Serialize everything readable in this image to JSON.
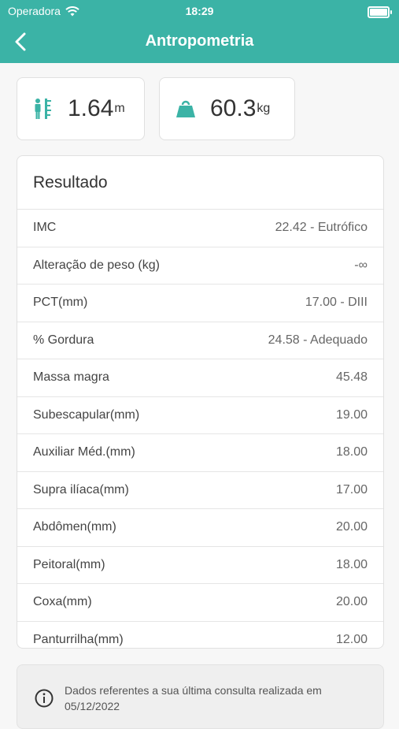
{
  "status_bar": {
    "carrier": "Operadora",
    "time": "18:29",
    "wifi_icon": "wifi-icon",
    "battery_icon": "battery-icon"
  },
  "nav": {
    "title": "Antropometria",
    "back_icon": "chevron-left-icon"
  },
  "metrics": {
    "height": {
      "value": "1.64",
      "unit": "m",
      "icon": "height-ruler-icon"
    },
    "weight": {
      "value": "60.3",
      "unit": "kg",
      "icon": "weight-icon"
    }
  },
  "results": {
    "title": "Resultado",
    "rows": [
      {
        "label": "IMC",
        "value": "22.42 - Eutrófico"
      },
      {
        "label": "Alteração de peso (kg)",
        "value": "-∞"
      },
      {
        "label": "PCT(mm)",
        "value": "17.00 - DIII"
      },
      {
        "label": "% Gordura",
        "value": "24.58 - Adequado"
      },
      {
        "label": "Massa magra",
        "value": "45.48"
      },
      {
        "label": "Subescapular(mm)",
        "value": "19.00"
      },
      {
        "label": "Auxiliar Méd.(mm)",
        "value": "18.00"
      },
      {
        "label": "Supra ilíaca(mm)",
        "value": "17.00"
      },
      {
        "label": "Abdômen(mm)",
        "value": "20.00"
      },
      {
        "label": "Peitoral(mm)",
        "value": "18.00"
      },
      {
        "label": "Coxa(mm)",
        "value": "20.00"
      },
      {
        "label": "Panturrilha(mm)",
        "value": "12.00"
      }
    ]
  },
  "info": {
    "icon": "info-icon",
    "text": "Dados referentes a sua última consulta realizada em 05/12/2022"
  },
  "colors": {
    "primary": "#3bb3a6",
    "background": "#f7f7f7"
  }
}
